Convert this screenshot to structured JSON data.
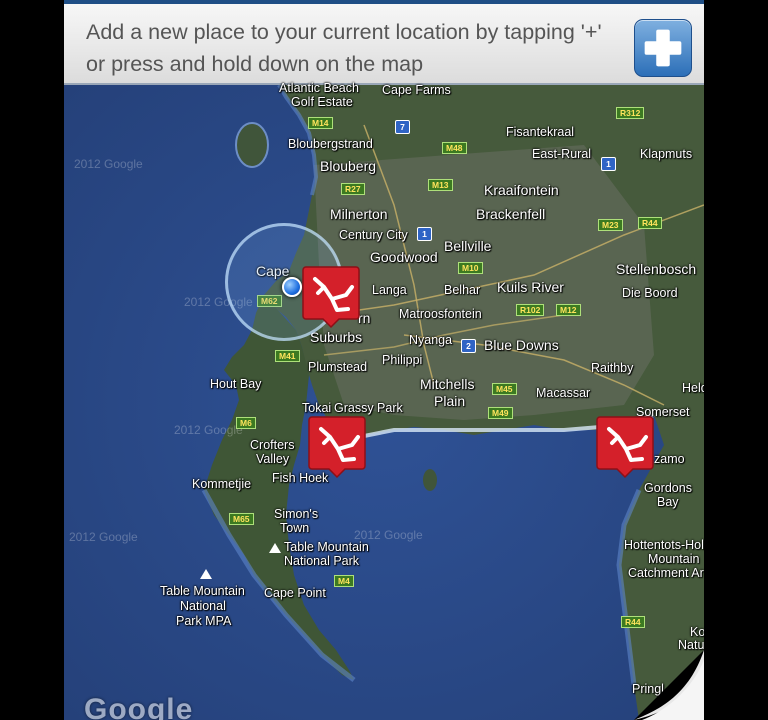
{
  "banner": {
    "text": "Add a new place to your current location by tapping '+' or press and hold down on the map",
    "add_button_icon": "plus-icon"
  },
  "map": {
    "watermarks": [
      "2012 Google",
      "2012 Google",
      "2012 Google",
      "2012 Google",
      "2012 Google"
    ],
    "places": {
      "atlantic_beach": "Atlantic Beach",
      "golf_estate": "Golf Estate",
      "cape_farms": "Cape Farms",
      "bloubergstrand": "Bloubergstrand",
      "blouberg": "Blouberg",
      "fisantekraal": "Fisantekraal",
      "east_rural": "East-Rural",
      "klapmuts": "Klapmuts",
      "kraaifontein": "Kraaifontein",
      "milnerton": "Milnerton",
      "brackenfell": "Brackenfell",
      "century_city": "Century City",
      "bellville": "Bellville",
      "goodwood": "Goodwood",
      "cape_town": "Cape",
      "stellenbosch": "Stellenbosch",
      "langa": "Langa",
      "belhar": "Belhar",
      "kuils_river": "Kuils River",
      "die_boord": "Die Boord",
      "matroosfontein": "Matroosfontein",
      "suburbs_top": "rn",
      "suburbs": "Suburbs",
      "nyanga": "Nyanga",
      "blue_downs": "Blue Downs",
      "philippi": "Philippi",
      "raithby": "Raithby",
      "hout_bay": "Hout Bay",
      "plumstead": "Plumstead",
      "mitchells": "Mitchells",
      "plain": "Plain",
      "macassar": "Macassar",
      "helder": "Held",
      "tokai": "Tokai",
      "grassy_park": "Grassy Park",
      "somerset": "Somerset",
      "crofters": "Crofters",
      "valley": "Valley",
      "strand": "zamo",
      "kommetjie": "Kommetjie",
      "fish_hoek": "Fish Hoek",
      "gordons": "Gordons",
      "bay": "Bay",
      "simons": "Simon's",
      "town": "Town",
      "hottentots1": "Hottentots-Holl",
      "hottentots2": "Mountain",
      "hottentots3": "Catchment Ar",
      "tmnp1": "Table Mountain",
      "tmnp2": "National Park",
      "cape_point": "Cape Point",
      "tmmpa1": "Table Mountain",
      "tmmpa2": "National",
      "tmmpa3": "Park MPA",
      "ko": "Ko",
      "natu": "Natu",
      "pringle": "Pringl"
    },
    "roads": [
      "R312",
      "M14",
      "M48",
      "R27",
      "M13",
      "M23",
      "R44",
      "M10",
      "M62",
      "R102",
      "M12",
      "M41",
      "M45",
      "M49",
      "M6",
      "M65",
      "M4",
      "R44"
    ],
    "routes": [
      "7",
      "1",
      "1",
      "2"
    ],
    "logo": "Google"
  },
  "colors": {
    "ocean": "#2a4a87",
    "land": "#3e4f3a",
    "marker": "#d4202a",
    "banner_border": "#1f4f86"
  }
}
